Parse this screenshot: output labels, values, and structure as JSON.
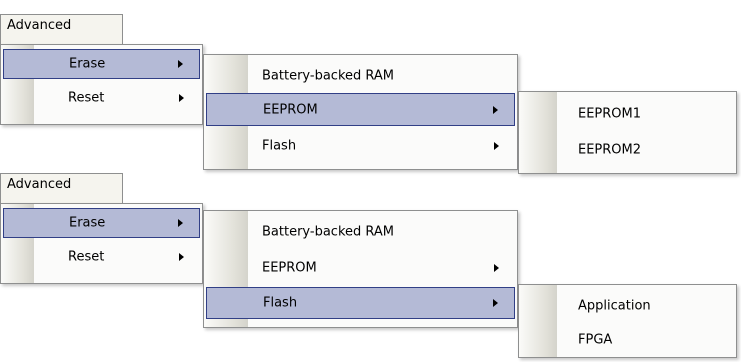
{
  "panels": [
    {
      "menubar_label": "Advanced",
      "level1": [
        {
          "label": "Erase",
          "highlighted": true,
          "submenu": true
        },
        {
          "label": "Reset",
          "highlighted": false,
          "submenu": true
        }
      ],
      "level2": [
        {
          "label": "Battery-backed RAM",
          "highlighted": false,
          "submenu": false
        },
        {
          "label": "EEPROM",
          "highlighted": true,
          "submenu": true
        },
        {
          "label": "Flash",
          "highlighted": false,
          "submenu": true
        }
      ],
      "level3": [
        {
          "label": "EEPROM1"
        },
        {
          "label": "EEPROM2"
        }
      ]
    },
    {
      "menubar_label": "Advanced",
      "level1": [
        {
          "label": "Erase",
          "highlighted": true,
          "submenu": true
        },
        {
          "label": "Reset",
          "highlighted": false,
          "submenu": true
        }
      ],
      "level2": [
        {
          "label": "Battery-backed RAM",
          "highlighted": false,
          "submenu": false
        },
        {
          "label": "EEPROM",
          "highlighted": false,
          "submenu": true
        },
        {
          "label": "Flash",
          "highlighted": true,
          "submenu": true
        }
      ],
      "level3": [
        {
          "label": "Application"
        },
        {
          "label": "FPGA"
        }
      ]
    }
  ],
  "colors": {
    "highlight_fill": "#b4bad6",
    "highlight_border": "#313f86",
    "menu_background": "#fbfbfa",
    "menu_border": "#8e8f8f"
  },
  "icons": {
    "submenu_arrow": "triangle-right-icon"
  }
}
